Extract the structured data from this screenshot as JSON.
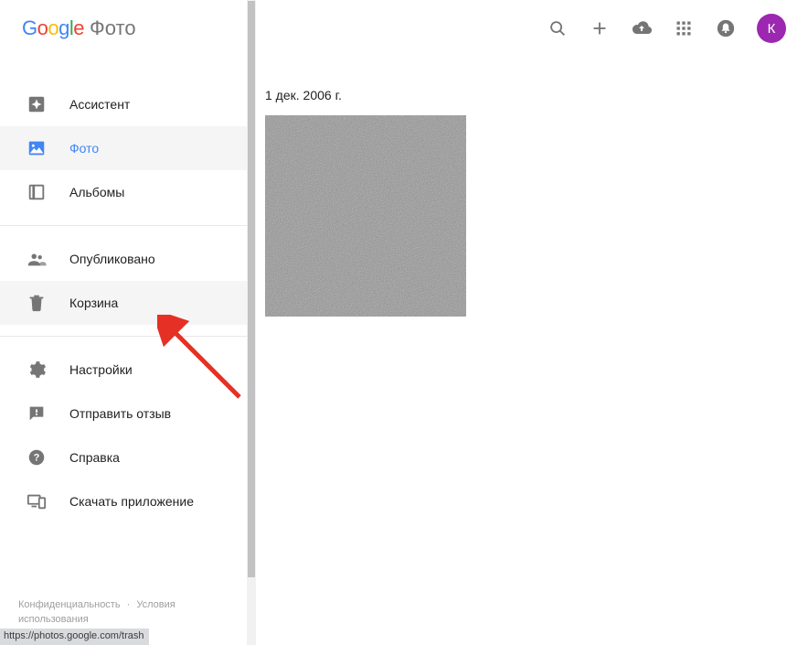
{
  "brand": {
    "g1": "G",
    "o1": "o",
    "o2": "o",
    "g2": "g",
    "l": "l",
    "e": "e",
    "suffix": "Фото"
  },
  "sidebar": {
    "items": [
      {
        "label": "Ассистент"
      },
      {
        "label": "Фото"
      },
      {
        "label": "Альбомы"
      },
      {
        "label": "Опубликовано"
      },
      {
        "label": "Корзина"
      },
      {
        "label": "Настройки"
      },
      {
        "label": "Отправить отзыв"
      },
      {
        "label": "Справка"
      },
      {
        "label": "Скачать приложение"
      }
    ]
  },
  "footer": {
    "privacy": "Конфиденциальность",
    "dot": "·",
    "terms": "Условия использования"
  },
  "header": {
    "avatar_letter": "К"
  },
  "main": {
    "date": "1 дек. 2006 г."
  },
  "status": {
    "url": "https://photos.google.com/trash"
  },
  "colors": {
    "accent": "#4285F4",
    "avatar_bg": "#9C27B0",
    "arrow": "#E53125"
  }
}
